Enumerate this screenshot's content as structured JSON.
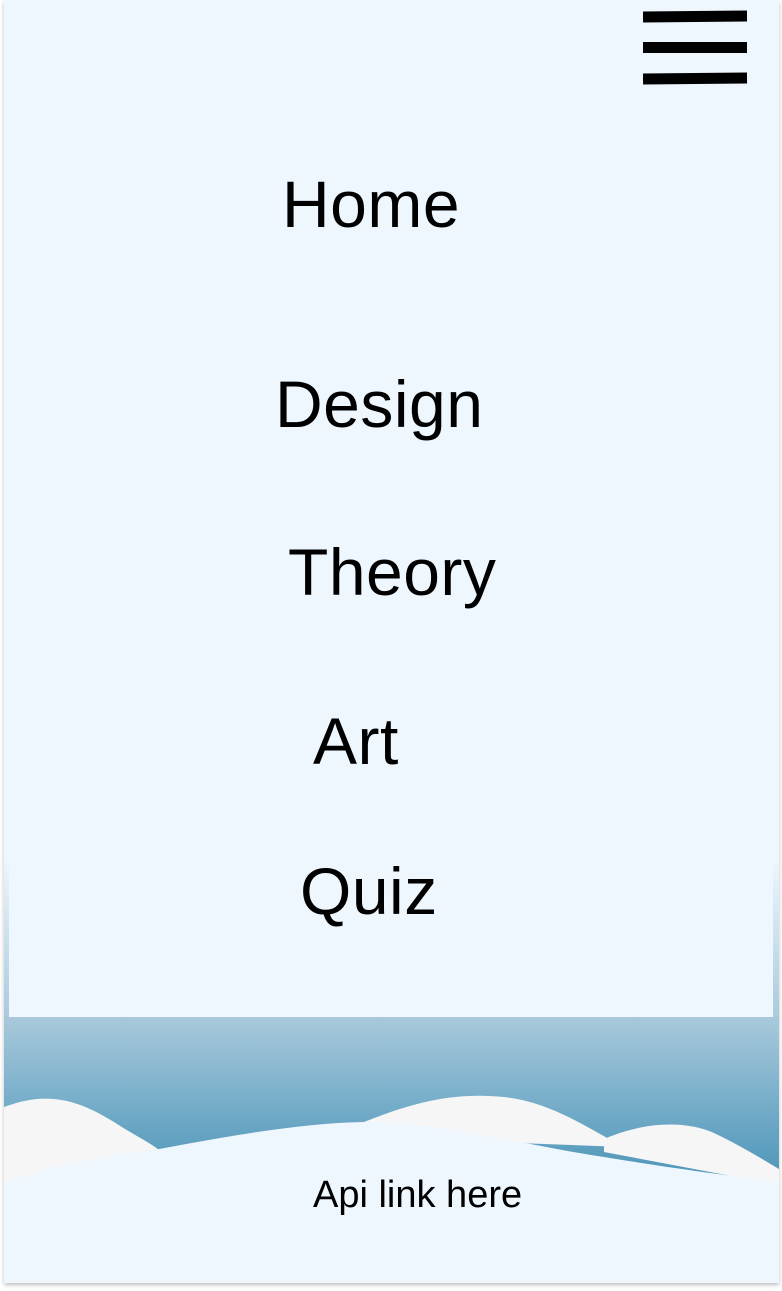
{
  "menu": {
    "icon": "hamburger-menu-icon"
  },
  "nav": {
    "items": [
      {
        "label": "Home"
      },
      {
        "label": "Design"
      },
      {
        "label": "Theory"
      },
      {
        "label": "Art"
      },
      {
        "label": "Quiz"
      }
    ]
  },
  "footer": {
    "link_text": "Api link here"
  },
  "colors": {
    "background": "#eef6fe",
    "wave_top": "#a9c9db",
    "wave_bottom": "#4f97b8",
    "hill": "#f6f6f6",
    "text": "#000000"
  }
}
